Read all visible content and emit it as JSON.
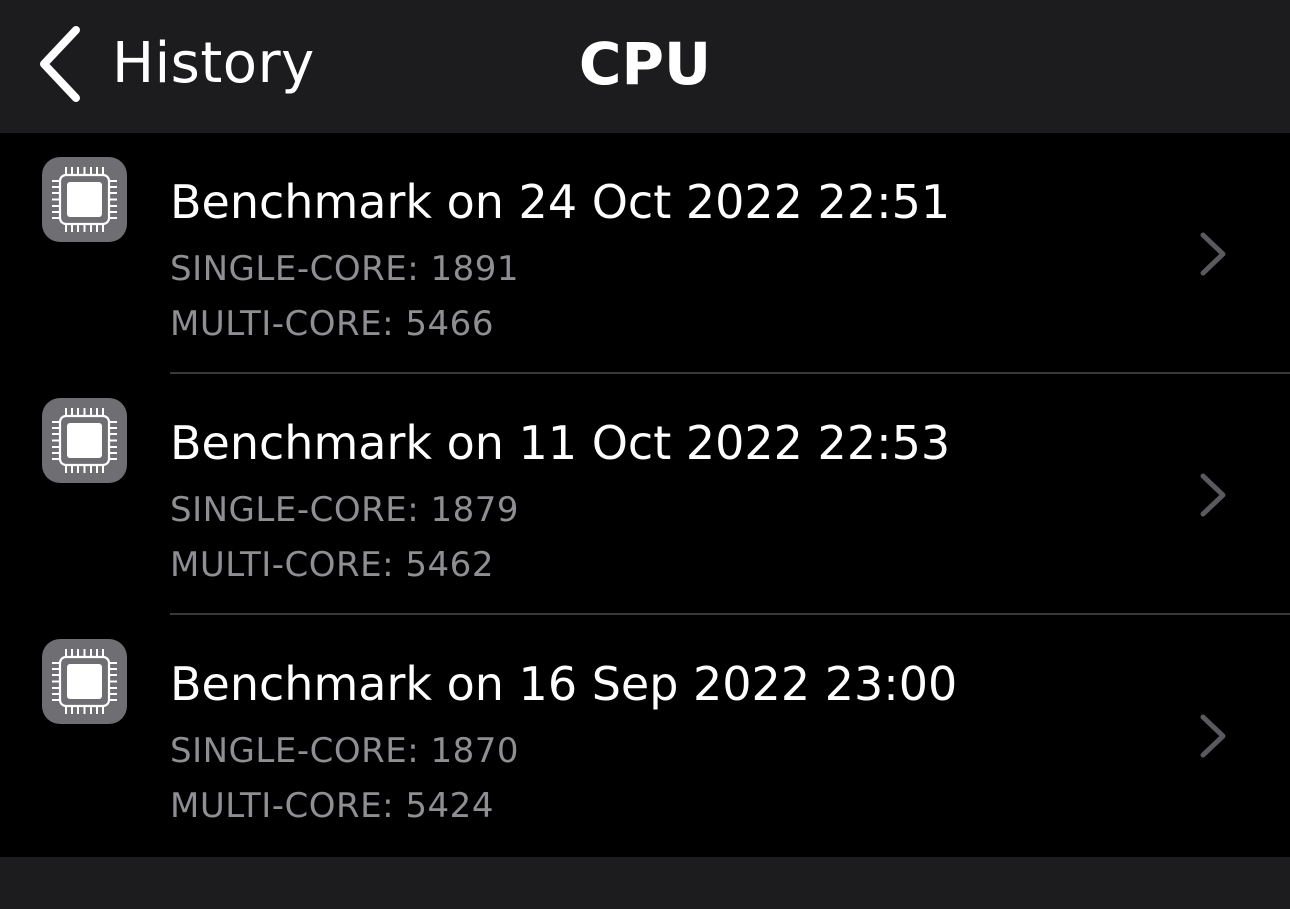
{
  "navbar": {
    "back_label": "History",
    "title": "CPU"
  },
  "benchmarks": [
    {
      "title": "Benchmark on 24 Oct 2022 22:51",
      "single_core": "SINGLE-CORE: 1891",
      "multi_core": "MULTI-CORE: 5466",
      "icon": "cpu-chip-icon"
    },
    {
      "title": "Benchmark on 11 Oct 2022 22:53",
      "single_core": "SINGLE-CORE: 1879",
      "multi_core": "MULTI-CORE: 5462",
      "icon": "cpu-chip-icon"
    },
    {
      "title": "Benchmark on 16 Sep 2022 23:00",
      "single_core": "SINGLE-CORE: 1870",
      "multi_core": "MULTI-CORE: 5424",
      "icon": "cpu-chip-icon"
    }
  ],
  "colors": {
    "background": "#000000",
    "navbar": "#1c1c1e",
    "text_primary": "#ffffff",
    "text_secondary": "#8e8e93",
    "icon_tile": "#6e6e73",
    "chevron": "#5a5a5e"
  }
}
